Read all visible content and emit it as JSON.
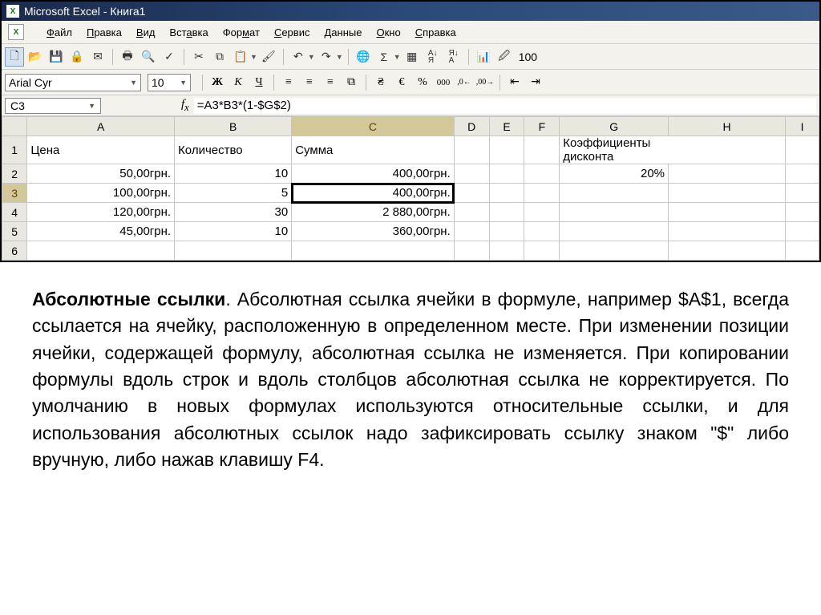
{
  "titlebar": {
    "text": "Microsoft Excel - Книга1"
  },
  "menubar": {
    "items": [
      {
        "label": "Файл",
        "ul": "Ф"
      },
      {
        "label": "Правка",
        "ul": "П"
      },
      {
        "label": "Вид",
        "ul": "В"
      },
      {
        "label": "Вставка",
        "ul": "а"
      },
      {
        "label": "Формат",
        "ul": "м"
      },
      {
        "label": "Сервис",
        "ul": "С"
      },
      {
        "label": "Данные",
        "ul": "Д"
      },
      {
        "label": "Окно",
        "ul": "О"
      },
      {
        "label": "Справка",
        "ul": "С"
      }
    ]
  },
  "toolbar1": {
    "zoom": "100"
  },
  "toolbar2": {
    "font": "Arial Cyr",
    "size": "10"
  },
  "formula_bar": {
    "cell_ref": "C3",
    "formula": "=A3*B3*(1-$G$2)"
  },
  "grid": {
    "columns": [
      "A",
      "B",
      "C",
      "D",
      "E",
      "F",
      "G",
      "H",
      "I"
    ],
    "selected_col": "C",
    "selected_row": "3",
    "rows": [
      {
        "n": "1",
        "cells": {
          "A": "Цена",
          "B": "Количество",
          "C": "Сумма",
          "G": "Коэффициенты дисконта"
        }
      },
      {
        "n": "2",
        "cells": {
          "A": "50,00грн.",
          "B": "10",
          "C": "400,00грн.",
          "G": "20%"
        }
      },
      {
        "n": "3",
        "cells": {
          "A": "100,00грн.",
          "B": "5",
          "C": "400,00грн."
        }
      },
      {
        "n": "4",
        "cells": {
          "A": "120,00грн.",
          "B": "30",
          "C": "2 880,00грн."
        }
      },
      {
        "n": "5",
        "cells": {
          "A": "45,00грн.",
          "B": "10",
          "C": "360,00грн."
        }
      },
      {
        "n": "6",
        "cells": {}
      }
    ]
  },
  "explainer": {
    "title": "Абсолютные ссылки",
    "body": ".    Абсолютная ссылка ячейки в формуле, например $A$1, всегда ссылается на ячейку, расположенную в определенном месте. При изменении позиции ячейки, содержащей формулу, абсолютная ссылка не изменяется. При копировании формулы вдоль строк и вдоль столбцов абсолютная ссылка не корректируется. По умолчанию в новых формулах используются относительные ссылки, и для использования абсолютных ссылок надо зафиксировать ссылку знаком \"$\" либо вручную, либо нажав клавишу F4."
  }
}
